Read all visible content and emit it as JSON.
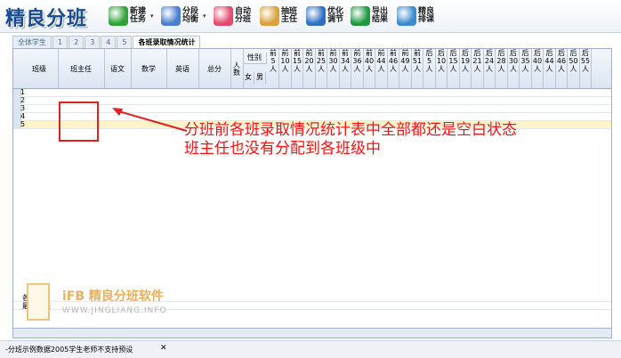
{
  "app_title": "精良分班",
  "toolbar": [
    {
      "label": "新建任务",
      "color": "#2fa336",
      "has_arrow": true
    },
    {
      "label": "分段均衡",
      "color": "#4a7fd0",
      "has_arrow": true
    },
    {
      "label": "自动分班",
      "color": "#e24a6e",
      "has_arrow": false
    },
    {
      "label": "抽班主任",
      "color": "#d9a13a",
      "has_arrow": false
    },
    {
      "label": "优化调节",
      "color": "#2f6fc4",
      "has_arrow": false
    },
    {
      "label": "导出结果",
      "color": "#1f9a3f",
      "has_arrow": false
    },
    {
      "label": "精良排课",
      "color": "#3b8bd0",
      "has_arrow": false
    }
  ],
  "tabs": [
    "全体学生",
    "1",
    "2",
    "3",
    "4",
    "5",
    "各班录取情况统计"
  ],
  "table": {
    "headers": [
      "班级",
      "班主任",
      "语文",
      "数学",
      "英语",
      "总分",
      "人数"
    ],
    "gender_group": "性别",
    "gender_sub": [
      "女",
      "男"
    ],
    "rank_cols": [
      "前5人",
      "前10人",
      "前15人",
      "前20人",
      "前25人",
      "前30人",
      "前34人",
      "前36人",
      "前40人",
      "前44人",
      "前46人",
      "前49人",
      "前51人",
      "后5人",
      "后10人",
      "后15人",
      "后19人",
      "后21人",
      "后24人",
      "后28人",
      "后30人",
      "后35人",
      "后40人",
      "后44人",
      "后46人",
      "后50人",
      "后55人"
    ],
    "rows": [
      "1",
      "2",
      "3",
      "4",
      "5"
    ],
    "footer_rows": [
      "各班均",
      "最大相差"
    ]
  },
  "annotation": {
    "line1": "分班前各班录取情况统计表中全部都还是空白状态",
    "line2": "班主任也没有分配到各班级中"
  },
  "watermark": {
    "title": "iFB 精良分班软件",
    "url": "WWW.JINGLIANG.INFO"
  },
  "status_tab": "-分班示例数据2005学生老师不支持预设"
}
